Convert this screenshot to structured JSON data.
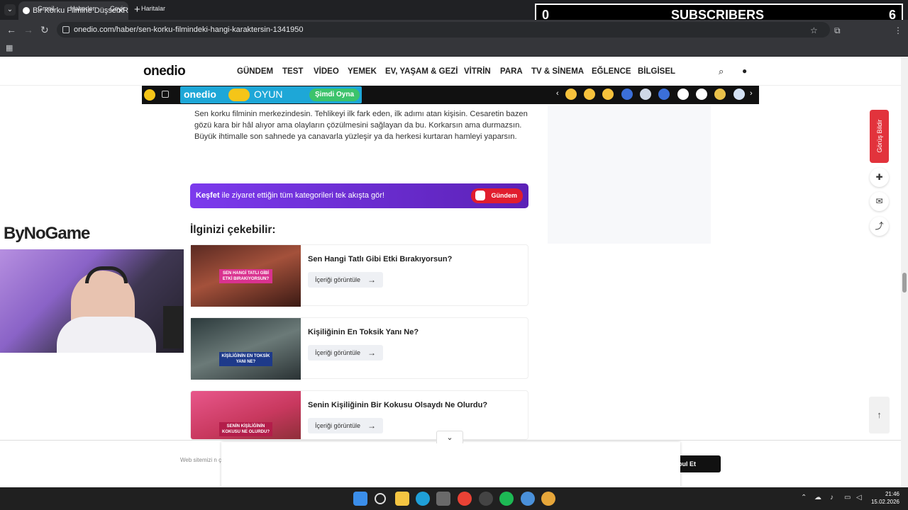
{
  "browser": {
    "tab_title": "Bir Korku Filmine Düşsen Rolün",
    "url": "onedio.com/haber/sen-korku-filmindeki-hangi-karaktersin-1341950",
    "bookmarks": [
      {
        "label": "Gmail",
        "color": "#ea4335"
      },
      {
        "label": "Haberler",
        "color": "#4285f4"
      },
      {
        "label": "Çevir",
        "color": "#4285f4"
      },
      {
        "label": "Haritalar",
        "color": "#34a853"
      }
    ]
  },
  "stream_overlay": {
    "left_count": "0",
    "label": "SUBSCRIBERS",
    "right_count": "6"
  },
  "site": {
    "logo": "onedio",
    "nav": [
      "GÜNDEM",
      "TEST",
      "VİDEO",
      "YEMEK",
      "EV, YAŞAM & GEZİ",
      "VİTRİN",
      "PARA",
      "TV & SİNEMA",
      "EĞLENCE",
      "BİLGİSEL"
    ],
    "promo": {
      "brand": "onedio",
      "game": "OYUN",
      "cta": "Şimdi Oyna"
    }
  },
  "article": {
    "paragraph": "Sen korku filminin merkezindesin. Tehlikeyi ilk fark eden, ilk adımı atan kişisin. Cesaretin bazen gözü kara bir hâl alıyor ama olayların çözülmesini sağlayan da bu. Korkarsın ama durmazsın. Büyük ihtimalle son sahnede ya canavarla yüzleşir ya da herkesi kurtaran hamleyi yaparsın."
  },
  "kesfet_banner": {
    "bold": "Keşfet",
    "text": " ile ziyaret ettiğin tüm kategorileri tek akışta gör!",
    "pill": "Gündem"
  },
  "related": {
    "title": "İlginizi çekebilir:",
    "button_label": "İçeriği görüntüle",
    "items": [
      {
        "title": "Sen Hangi Tatlı Gibi Etki Bırakıyorsun?",
        "caption": "SEN HANGİ TATLI GİBİ ETKİ BIRAKIYORSUN?"
      },
      {
        "title": "Kişiliğinin En Toksik Yanı Ne?",
        "caption": "KİŞİLİĞİNİN EN TOKSİK YANI NE?"
      },
      {
        "title": "Senin Kişiliğinin Bir Kokusu Olsaydı Ne Olurdu?",
        "caption": "SENİN KİŞİLİĞİNİN KOKUSU NE OLURDU?"
      }
    ]
  },
  "side": {
    "feedback": "Görüş Bildir"
  },
  "webcam": {
    "brand": "ByNoGame"
  },
  "cookie": {
    "text": "Web sitemizi n çerezler kullan",
    "button": "bul Et"
  },
  "taskbar": {
    "time": "21:46",
    "date": "15.02.2026"
  }
}
